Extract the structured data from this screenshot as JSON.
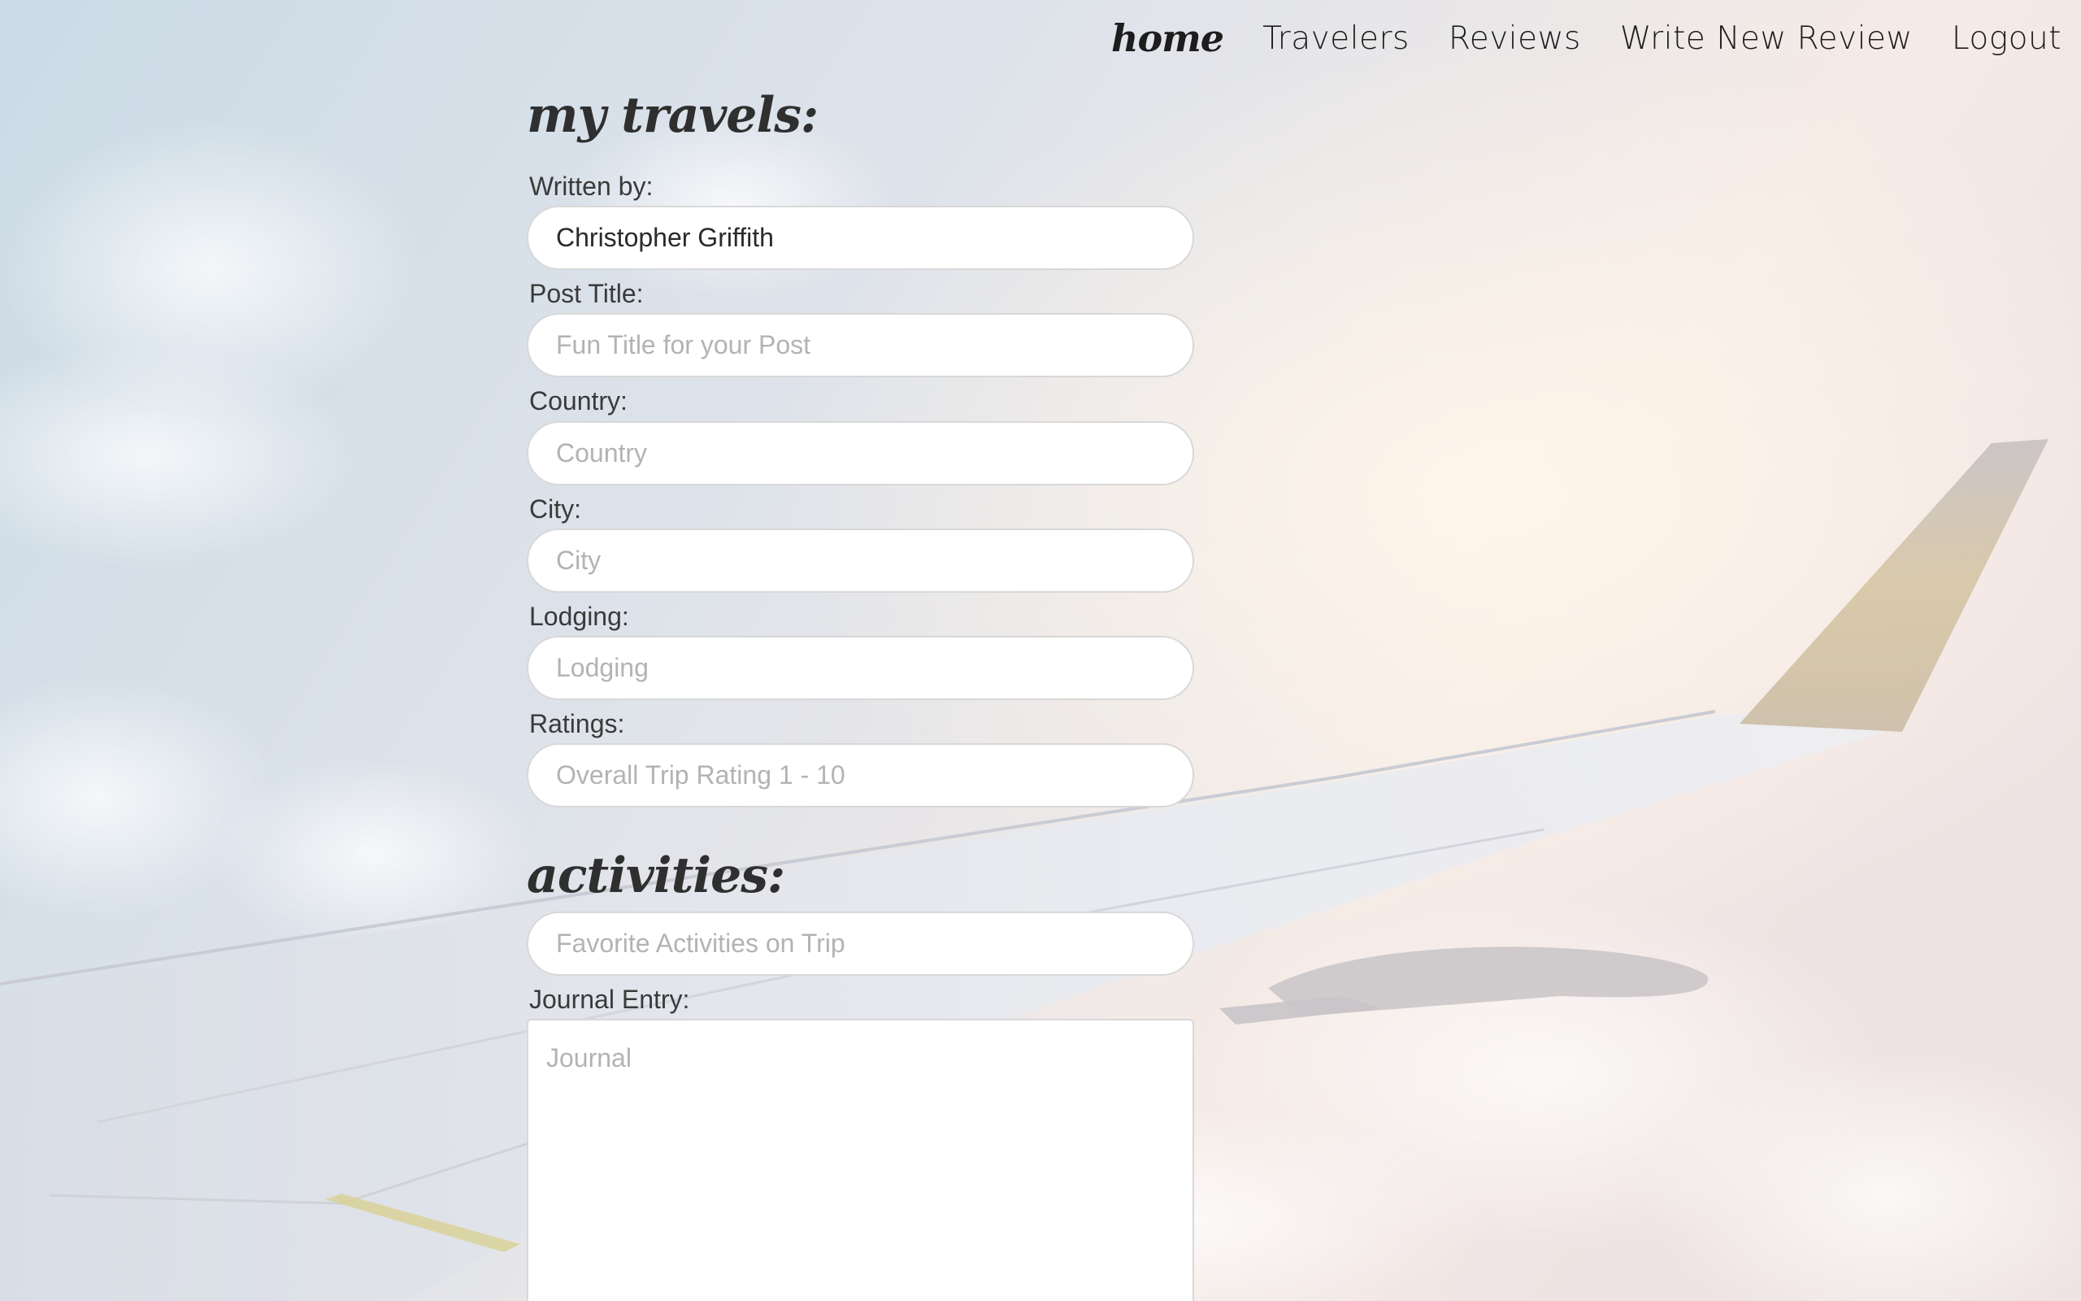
{
  "nav": {
    "home": "home",
    "travelers": "Travelers",
    "reviews": "Reviews",
    "write_review": "Write New Review",
    "logout": "Logout"
  },
  "page": {
    "heading": "my travels:",
    "activities_heading": "activities:"
  },
  "form": {
    "written_by": {
      "label": "Written by:",
      "value": "Christopher Griffith"
    },
    "post_title": {
      "label": "Post Title:",
      "placeholder": "Fun Title for your Post"
    },
    "country": {
      "label": "Country:",
      "placeholder": "Country"
    },
    "city": {
      "label": "City:",
      "placeholder": "City"
    },
    "lodging": {
      "label": "Lodging:",
      "placeholder": "Lodging"
    },
    "ratings": {
      "label": "Ratings:",
      "placeholder": "Overall Trip Rating 1 - 10"
    },
    "activities": {
      "placeholder": "Favorite Activities on Trip"
    },
    "journal": {
      "label": "Journal Entry:",
      "placeholder": "Journal"
    }
  },
  "colors": {
    "sky_left": "#cfdde8",
    "sky_right": "#f3e6e0",
    "wing": "#e7e9ee",
    "input_bg": "#ffffff",
    "text": "#333333",
    "placeholder": "#b3b3b3"
  },
  "background": {
    "image": "airplane-wing-above-clouds"
  }
}
